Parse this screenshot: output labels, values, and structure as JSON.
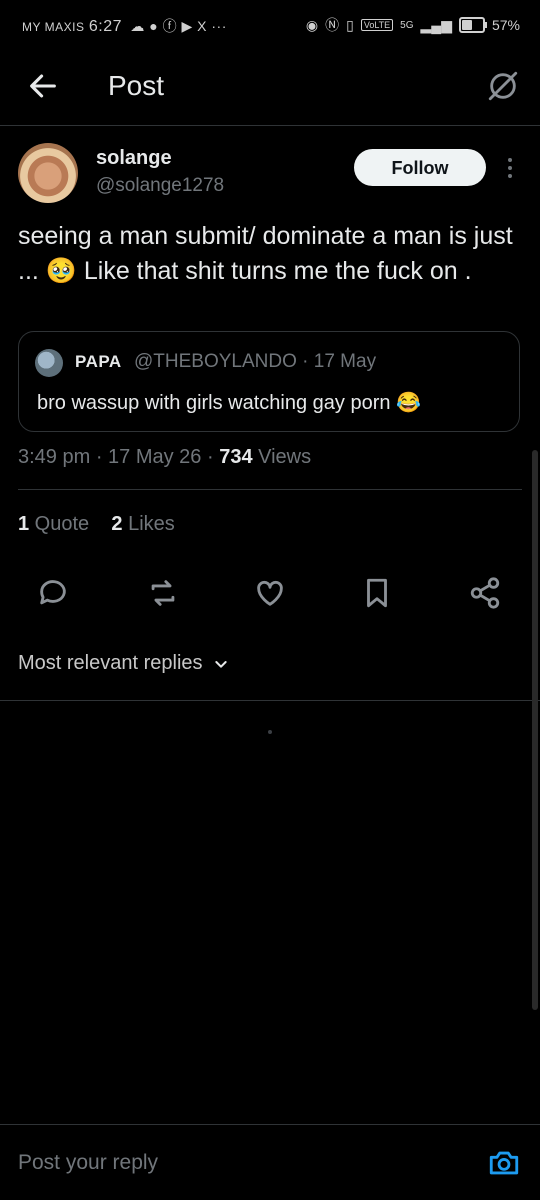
{
  "status": {
    "carrier": "MY MAXIS",
    "time": "6:27",
    "icons_left": "☁ ● ⓕ ▶ X ···",
    "network": "5G",
    "volte": "VoLTE",
    "battery": "57%",
    "battery_level": 0.57
  },
  "header": {
    "title": "Post",
    "back_icon": "arrow-left-icon",
    "grok_icon": "grok-icon"
  },
  "post": {
    "author_name": "solange",
    "author_handle": "@solange1278",
    "follow_label": "Follow",
    "text": "seeing a man submit/ dominate a man is just ... 🥹 Like that shit turns me the fuck on .",
    "quote": {
      "name": "PAPA",
      "handle_date": "@THEBOYLANDO · 17 May",
      "text": "bro wassup with girls watching gay porn 😂"
    },
    "time": "3:49 pm · 17 May 26 · ",
    "views_count": "734",
    "views_label": " Views",
    "quote_count": "1",
    "quote_label": " Quote",
    "likes_count": "2",
    "likes_label": " Likes"
  },
  "actions": [
    "reply-icon",
    "repost-icon",
    "like-icon",
    "bookmark-icon",
    "share-icon"
  ],
  "replies_sort": "Most relevant replies",
  "composer": {
    "placeholder": "Post your reply",
    "camera_icon": "camera-icon"
  },
  "colors": {
    "accent": "#1d9bf0",
    "text": "#e7e9ea",
    "muted": "#71767b",
    "border": "#2f3336"
  }
}
